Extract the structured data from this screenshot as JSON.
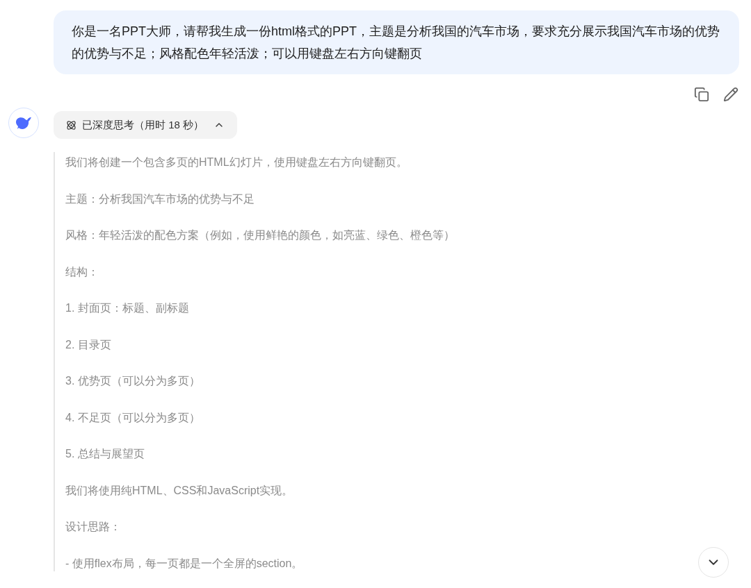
{
  "user_message": {
    "text": "你是一名PPT大师，请帮我生成一份html格式的PPT，主题是分析我国的汽车市场，要求充分展示我国汽车市场的优势的优势与不足；风格配色年轻活泼；可以用键盘左右方向键翻页"
  },
  "thinking": {
    "label": "已深度思考（用时 18 秒）",
    "expanded": true
  },
  "thought_paragraphs": [
    "我们将创建一个包含多页的HTML幻灯片，使用键盘左右方向键翻页。",
    "主题：分析我国汽车市场的优势与不足",
    "风格：年轻活泼的配色方案（例如，使用鲜艳的颜色，如亮蓝、绿色、橙色等）",
    "结构：",
    "1. 封面页：标题、副标题",
    "2. 目录页",
    "3. 优势页（可以分为多页）",
    "4. 不足页（可以分为多页）",
    "5. 总结与展望页",
    "我们将使用纯HTML、CSS和JavaScript实现。",
    "设计思路：",
    "- 使用flex布局，每一页都是一个全屏的section。"
  ]
}
